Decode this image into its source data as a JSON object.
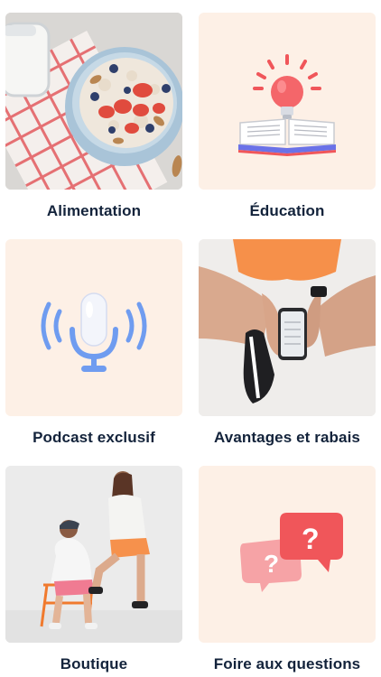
{
  "categories": [
    {
      "label": "Alimentation",
      "image": "oatmeal-bowl-photo"
    },
    {
      "label": "Éducation",
      "image": "lightbulb-book-icon"
    },
    {
      "label": "Podcast exclusif",
      "image": "microphone-icon"
    },
    {
      "label": "Avantages et rabais",
      "image": "phone-in-hand-photo"
    },
    {
      "label": "Boutique",
      "image": "two-women-apparel-photo"
    },
    {
      "label": "Foire aux questions",
      "image": "question-bubbles-icon"
    }
  ],
  "colors": {
    "tile_background": "#fdf0e6",
    "label_text": "#13233b",
    "accent_coral": "#f0565a",
    "accent_blue": "#6f9cf0"
  }
}
